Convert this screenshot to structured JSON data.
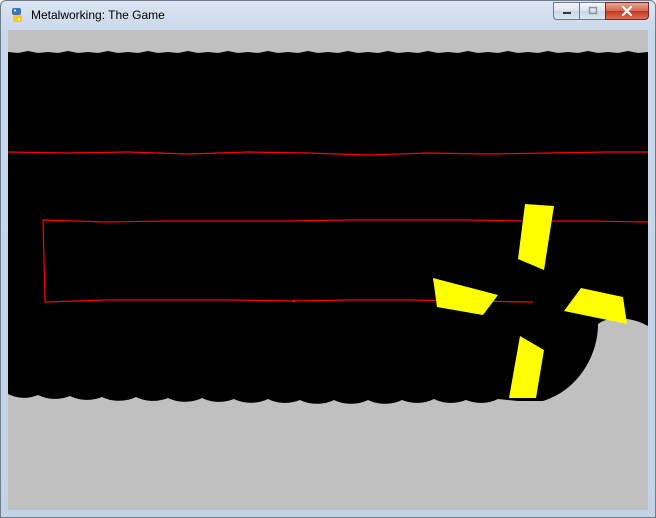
{
  "window": {
    "title": "Metalworking: The Game",
    "app_icon": "python-snake-icon",
    "controls": [
      "minimize-icon",
      "maximize-icon",
      "close-icon"
    ]
  },
  "game": {
    "colors": {
      "background": "#c0c0c0",
      "metal": "#000000",
      "cut_lines": "#ff0000",
      "blade": "#ffff00"
    }
  }
}
